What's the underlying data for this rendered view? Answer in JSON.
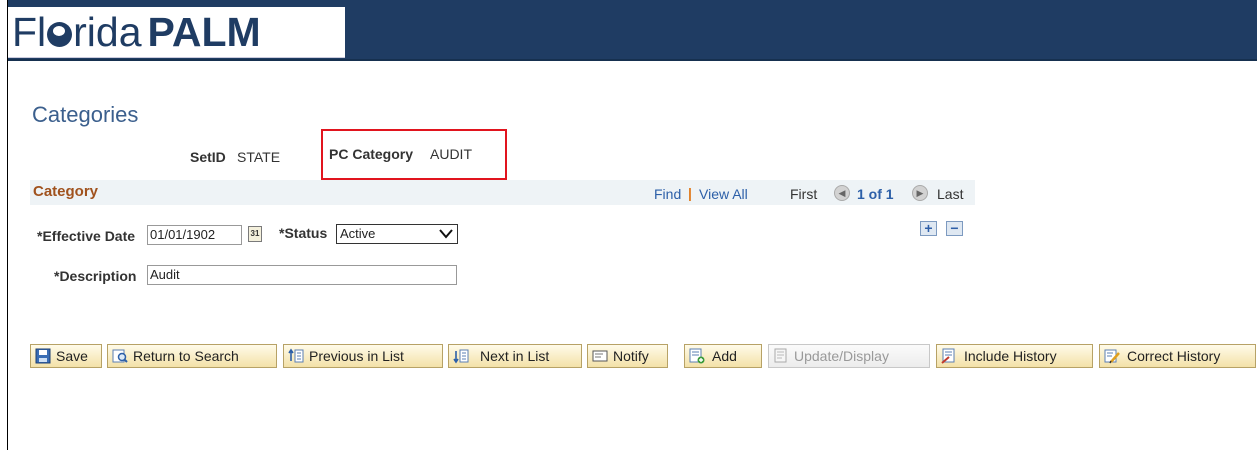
{
  "header": {
    "logo_light": "Fl",
    "logo_light_2": "rida",
    "logo_bold": "PALM"
  },
  "page": {
    "title": "Categories"
  },
  "keys": {
    "setid_label": "SetID",
    "setid_value": "STATE",
    "pc_category_label": "PC Category",
    "pc_category_value": "AUDIT"
  },
  "category_section": {
    "title": "Category",
    "find_label": "Find",
    "view_all_label": "View All",
    "first_label": "First",
    "page_indicator": "1 of 1",
    "last_label": "Last"
  },
  "form": {
    "effective_date_label": "*Effective Date",
    "effective_date_value": "01/01/1902",
    "calendar_icon_text": "31",
    "status_label": "*Status",
    "status_value": "Active",
    "description_label": "*Description",
    "description_value": "Audit"
  },
  "toolbar": {
    "save": "Save",
    "return_to_search": "Return to Search",
    "previous_in_list": "Previous in List",
    "next_in_list": "Next in List",
    "notify": "Notify",
    "add": "Add",
    "update_display": "Update/Display",
    "include_history": "Include History",
    "correct_history": "Correct History"
  },
  "colors": {
    "header": "#1f3c63",
    "title": "#3b5f8d",
    "section_title": "#a0521e",
    "highlight": "#e1141e"
  }
}
